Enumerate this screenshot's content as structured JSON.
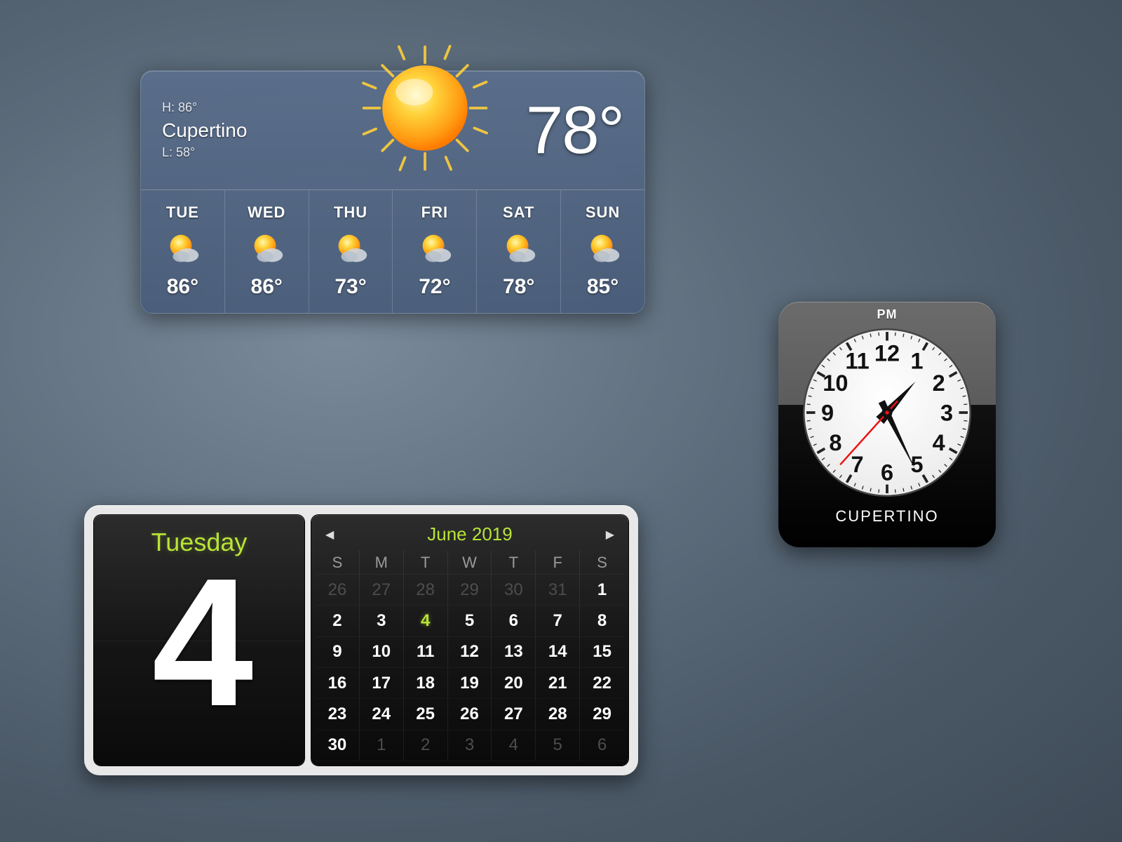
{
  "weather": {
    "hi_label": "H: 86°",
    "city": "Cupertino",
    "lo_label": "L: 58°",
    "current_temp": "78°",
    "forecast": [
      {
        "label": "TUE",
        "temp": "86°"
      },
      {
        "label": "WED",
        "temp": "86°"
      },
      {
        "label": "THU",
        "temp": "73°"
      },
      {
        "label": "FRI",
        "temp": "72°"
      },
      {
        "label": "SAT",
        "temp": "78°"
      },
      {
        "label": "SUN",
        "temp": "85°"
      }
    ]
  },
  "clock": {
    "ampm": "PM",
    "city": "CUPERTINO",
    "hour": 1,
    "minute": 25,
    "second": 37,
    "numerals": [
      "12",
      "1",
      "2",
      "3",
      "4",
      "5",
      "6",
      "7",
      "8",
      "9",
      "10",
      "11"
    ]
  },
  "calendar": {
    "weekday": "Tuesday",
    "day_number": "4",
    "month_label": "June 2019",
    "dows": [
      "S",
      "M",
      "T",
      "W",
      "T",
      "F",
      "S"
    ],
    "cells": [
      {
        "n": "26",
        "outside": true
      },
      {
        "n": "27",
        "outside": true
      },
      {
        "n": "28",
        "outside": true
      },
      {
        "n": "29",
        "outside": true
      },
      {
        "n": "30",
        "outside": true
      },
      {
        "n": "31",
        "outside": true
      },
      {
        "n": "1"
      },
      {
        "n": "2"
      },
      {
        "n": "3"
      },
      {
        "n": "4",
        "today": true
      },
      {
        "n": "5"
      },
      {
        "n": "6"
      },
      {
        "n": "7"
      },
      {
        "n": "8"
      },
      {
        "n": "9"
      },
      {
        "n": "10"
      },
      {
        "n": "11"
      },
      {
        "n": "12"
      },
      {
        "n": "13"
      },
      {
        "n": "14"
      },
      {
        "n": "15"
      },
      {
        "n": "16"
      },
      {
        "n": "17"
      },
      {
        "n": "18"
      },
      {
        "n": "19"
      },
      {
        "n": "20"
      },
      {
        "n": "21"
      },
      {
        "n": "22"
      },
      {
        "n": "23"
      },
      {
        "n": "24"
      },
      {
        "n": "25"
      },
      {
        "n": "26"
      },
      {
        "n": "27"
      },
      {
        "n": "28"
      },
      {
        "n": "29"
      },
      {
        "n": "30"
      },
      {
        "n": "1",
        "outside": true
      },
      {
        "n": "2",
        "outside": true
      },
      {
        "n": "3",
        "outside": true
      },
      {
        "n": "4",
        "outside": true
      },
      {
        "n": "5",
        "outside": true
      },
      {
        "n": "6",
        "outside": true
      }
    ]
  }
}
